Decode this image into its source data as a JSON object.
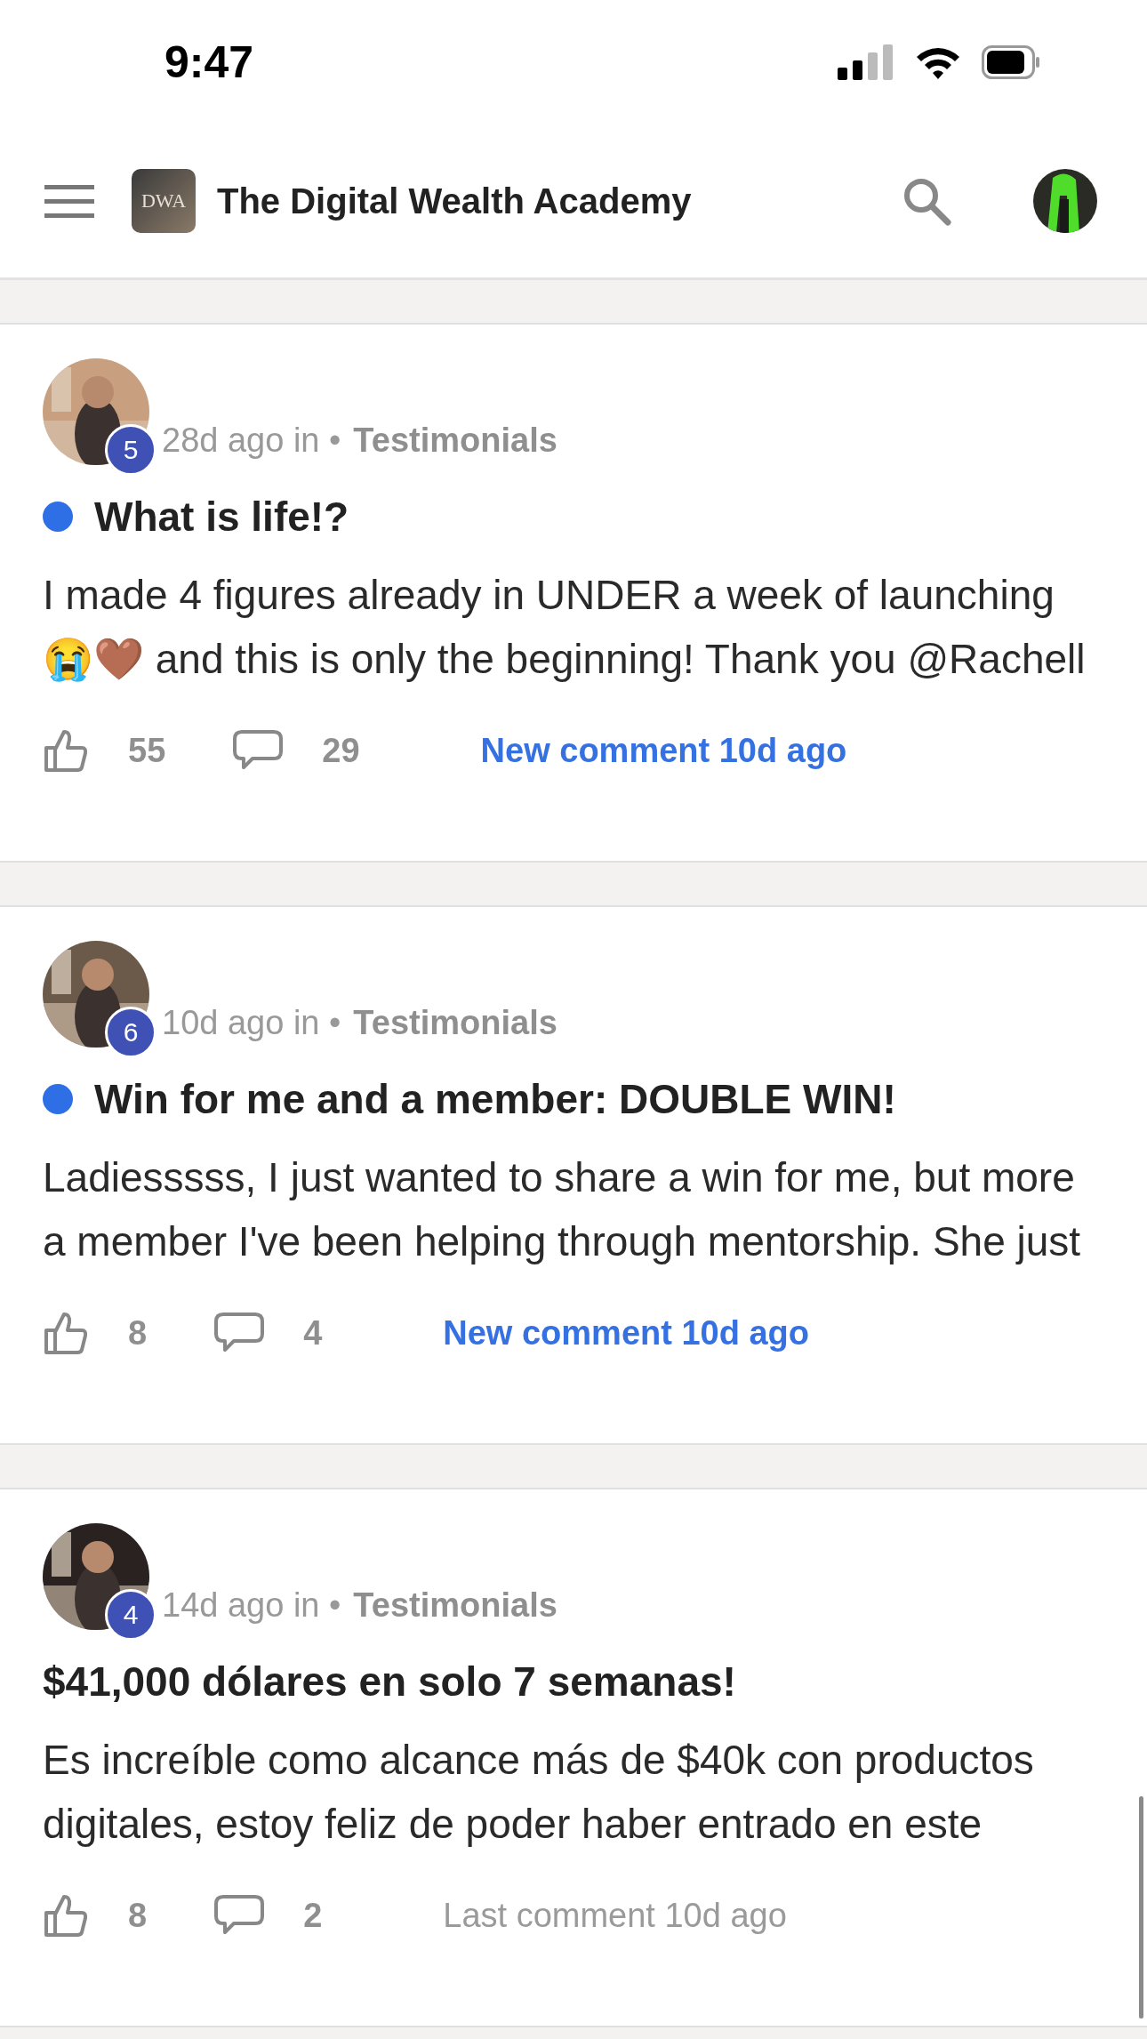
{
  "status_bar": {
    "time": "9:47"
  },
  "header": {
    "logo": "DWA",
    "title": "The Digital Wealth Academy"
  },
  "posts": [
    {
      "level": "5",
      "time": "28d ago in •",
      "category": "Testimonials",
      "unread": true,
      "title": "What is life!?",
      "lines": [
        "I made 4 figures already in UNDER a week of launching",
        "😭🤎 and this is only the beginning! Thank you @Rachell"
      ],
      "likes": "55",
      "comments": "29",
      "activity": "New comment 10d ago",
      "new_activity": true
    },
    {
      "level": "6",
      "time": "10d ago in •",
      "category": "Testimonials",
      "unread": true,
      "title": "Win for me and a member: DOUBLE WIN!",
      "lines": [
        "Ladiesssss, I just wanted to share a win for me, but more",
        "a member I've been helping through mentorship. She just"
      ],
      "likes": "8",
      "comments": "4",
      "activity": "New comment 10d ago",
      "new_activity": true
    },
    {
      "level": "4",
      "time": "14d ago in •",
      "category": "Testimonials",
      "unread": false,
      "title": "$41,000 dólares en solo 7 semanas!",
      "lines": [
        "Es increíble como alcance más de $40k con productos",
        "digitales, estoy feliz de poder haber entrado en este"
      ],
      "likes": "8",
      "comments": "2",
      "activity": "Last comment 10d ago",
      "new_activity": false
    }
  ]
}
